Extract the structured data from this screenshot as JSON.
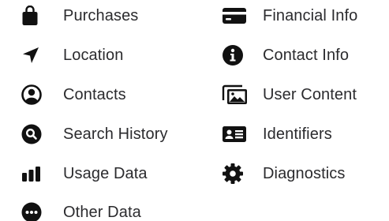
{
  "colors": {
    "icon": "#111111",
    "text": "#2b2b2e",
    "background": "#ffffff"
  },
  "left_items": [
    {
      "label": "Purchases",
      "icon": "bag-icon"
    },
    {
      "label": "Location",
      "icon": "location-arrow-icon"
    },
    {
      "label": "Contacts",
      "icon": "person-circle-icon"
    },
    {
      "label": "Search History",
      "icon": "magnifier-circle-icon"
    },
    {
      "label": "Usage Data",
      "icon": "bar-chart-icon"
    },
    {
      "label": "Other Data",
      "icon": "ellipsis-circle-icon"
    }
  ],
  "right_items": [
    {
      "label": "Financial Info",
      "icon": "credit-card-icon"
    },
    {
      "label": "Contact Info",
      "icon": "info-circle-icon"
    },
    {
      "label": "User Content",
      "icon": "photos-icon"
    },
    {
      "label": "Identifiers",
      "icon": "id-card-icon"
    },
    {
      "label": "Diagnostics",
      "icon": "gear-icon"
    }
  ]
}
